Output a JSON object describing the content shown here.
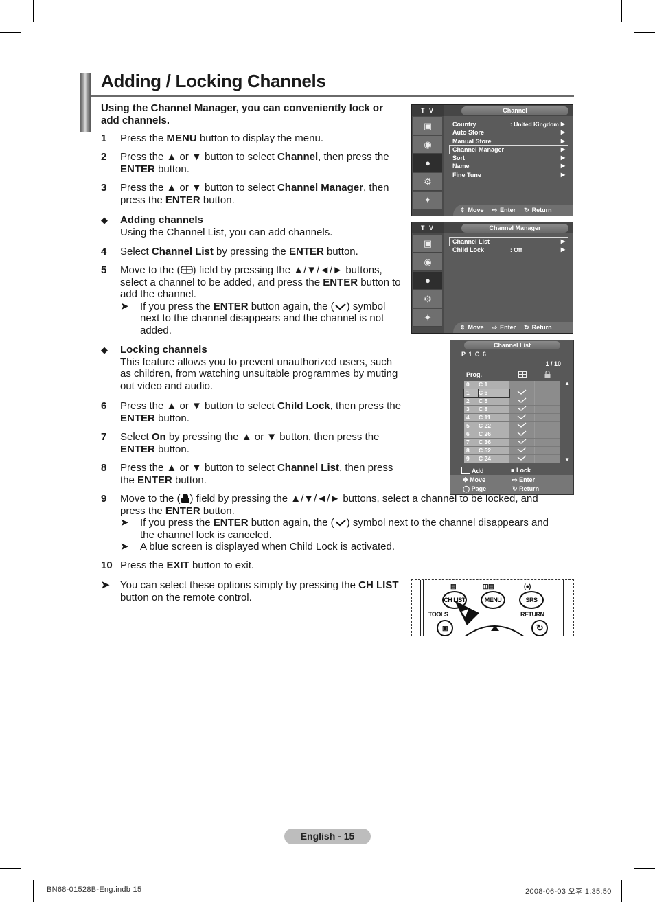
{
  "page": {
    "title": "Adding / Locking Channels",
    "intro": "Using the Channel Manager, you can conveniently lock or add channels.",
    "steps": [
      {
        "num": "1",
        "parts": [
          "Press the ",
          "MENU",
          " button to display the menu."
        ]
      },
      {
        "num": "2",
        "parts": [
          "Press the ▲ or ▼ button to select ",
          "Channel",
          ", then press the ",
          "ENTER",
          " button."
        ]
      },
      {
        "num": "3",
        "parts": [
          "Press the ▲ or ▼ button to select ",
          "Channel Manager",
          ", then press the ",
          "ENTER",
          " button."
        ]
      },
      {
        "num": "4",
        "parts": [
          "Select ",
          "Channel List",
          " by pressing the ",
          "ENTER",
          " button."
        ]
      },
      {
        "num": "5",
        "parts": [
          "Move to the (",
          "add-icon",
          ") field by pressing the ▲/▼/◄/► buttons, select a channel to be added, and press the ",
          "ENTER",
          " button to add the channel."
        ]
      },
      {
        "num": "6",
        "parts": [
          "Press the ▲ or ▼ button to select ",
          "Child Lock",
          ", then press the ",
          "ENTER",
          " button."
        ]
      },
      {
        "num": "7",
        "parts": [
          "Select ",
          "On",
          " by pressing the ▲ or ▼ button, then press the ",
          "ENTER",
          " button."
        ]
      },
      {
        "num": "8",
        "parts": [
          "Press the ▲ or ▼ button to select ",
          "Channel List",
          ", then press the ",
          "ENTER",
          " button."
        ]
      },
      {
        "num": "9",
        "parts": [
          "Move to the (",
          "lock-icon",
          ") field by pressing the ▲/▼/◄/► buttons, select a channel to be locked, and press the ",
          "ENTER",
          " button."
        ]
      },
      {
        "num": "10",
        "parts": [
          "Press the ",
          "EXIT",
          " button to exit."
        ]
      }
    ],
    "adding_heading": "Adding channels",
    "adding_desc": "Using the Channel List, you can add channels.",
    "locking_heading": "Locking channels",
    "locking_desc": "This feature allows you to prevent unauthorized users, such as children, from watching unsuitable programmes by muting out video and audio.",
    "note5": [
      "If you press the ",
      "ENTER",
      " button again, the (",
      "check",
      ") symbol next to the channel disappears and the channel is not added."
    ],
    "note9a": [
      "If you press the ",
      "ENTER",
      " button again, the (",
      "check",
      ") symbol next to the channel disappears and the channel lock is canceled."
    ],
    "note9b": "A blue screen is displayed when Child Lock is activated.",
    "tip": [
      "You can select these options simply by pressing the ",
      "CH LIST",
      " button on the remote control."
    ],
    "page_number": "English - 15",
    "slug_left": "BN68-01528B-Eng.indb   15",
    "slug_right": "2008-06-03   오후 1:35:50"
  },
  "osd_channel": {
    "source": "T V",
    "title": "Channel",
    "items": [
      {
        "label": "Country",
        "value": ": United Kingdom",
        "selected": false
      },
      {
        "label": "Auto Store",
        "value": "",
        "selected": false
      },
      {
        "label": "Manual Store",
        "value": "",
        "selected": false
      },
      {
        "label": "Channel Manager",
        "value": "",
        "selected": true
      },
      {
        "label": "Sort",
        "value": "",
        "selected": false
      },
      {
        "label": "Name",
        "value": "",
        "selected": false
      },
      {
        "label": "Fine Tune",
        "value": "",
        "selected": false
      }
    ],
    "footer": {
      "move": "Move",
      "enter": "Enter",
      "return": "Return"
    }
  },
  "osd_manager": {
    "source": "T V",
    "title": "Channel Manager",
    "items": [
      {
        "label": "Channel List",
        "value": "",
        "selected": true
      },
      {
        "label": "Child Lock",
        "value": ": Off",
        "selected": false
      }
    ],
    "footer": {
      "move": "Move",
      "enter": "Enter",
      "return": "Return"
    }
  },
  "channel_list": {
    "title": "Channel List",
    "current": "P  1   C 6",
    "page": "1 / 10",
    "prog_header": "Prog.",
    "rows": [
      {
        "prog": "0",
        "ch": "C 1",
        "added": false,
        "locked": false
      },
      {
        "prog": "1",
        "ch": "C 6",
        "added": true,
        "locked": false,
        "selected": true
      },
      {
        "prog": "2",
        "ch": "C 5",
        "added": true,
        "locked": false
      },
      {
        "prog": "3",
        "ch": "C 8",
        "added": true,
        "locked": false
      },
      {
        "prog": "4",
        "ch": "C 11",
        "added": true,
        "locked": false
      },
      {
        "prog": "5",
        "ch": "C 22",
        "added": true,
        "locked": false
      },
      {
        "prog": "6",
        "ch": "C 26",
        "added": true,
        "locked": false
      },
      {
        "prog": "7",
        "ch": "C 36",
        "added": true,
        "locked": false
      },
      {
        "prog": "8",
        "ch": "C 52",
        "added": true,
        "locked": false
      },
      {
        "prog": "9",
        "ch": "C 24",
        "added": true,
        "locked": false
      }
    ],
    "legend_add": "Add",
    "legend_lock": "Lock",
    "nav": {
      "move": "Move",
      "enter": "Enter",
      "page": "Page",
      "return": "Return"
    }
  },
  "remote": {
    "ch_list": "CH LIST",
    "menu": "MENU",
    "srs": "SRS",
    "tools": "TOOLS",
    "return": "RETURN"
  }
}
